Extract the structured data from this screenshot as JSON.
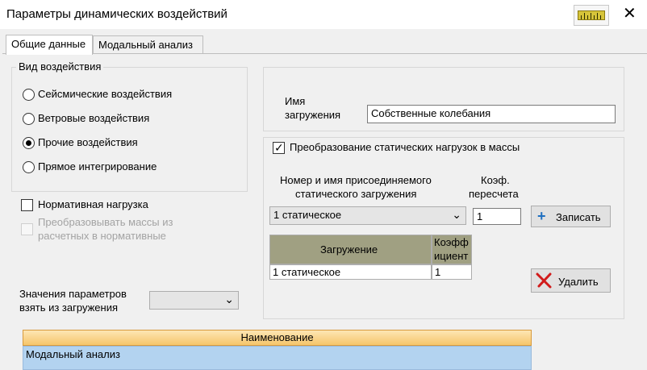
{
  "window": {
    "title": "Параметры динамических воздействий",
    "close_glyph": "✕"
  },
  "tabs": [
    {
      "label": "Общие данные"
    },
    {
      "label": "Модальный анализ"
    }
  ],
  "impact_type": {
    "title": "Вид воздействия",
    "options": [
      {
        "label": "Сейсмические воздействия",
        "selected": false
      },
      {
        "label": "Ветровые воздействия",
        "selected": false
      },
      {
        "label": "Прочие воздействия",
        "selected": true
      },
      {
        "label": "Прямое интегрирование",
        "selected": false
      }
    ]
  },
  "normative_load": {
    "label": "Нормативная нагрузка",
    "checked": false
  },
  "convert_masses": {
    "line1": "Преобразовывать массы из",
    "line2": "расчетных в нормативные",
    "checked": false,
    "disabled": true
  },
  "param_values": {
    "line1": "Значения параметров",
    "line2": "взять из загружения",
    "selected": ""
  },
  "load_name": {
    "label_line1": "Имя",
    "label_line2": "загружения",
    "value": "Собственные колебания"
  },
  "static_to_mass": {
    "checkbox_label": "Преобразование статических нагрузок в массы",
    "checked": true,
    "attach_label_line1": "Номер и имя присоединяемого",
    "attach_label_line2": "статического загружения",
    "coef_label_line1": "Коэф.",
    "coef_label_line2": "пересчета",
    "selected_load": "1 статическое",
    "coef_value": "1",
    "write_button": "Записать",
    "delete_button": "Удалить",
    "grid": {
      "headers": [
        "Загружение",
        "Коэфф",
        "ициент"
      ],
      "rows": [
        {
          "load": "1 статическое",
          "coef": "1"
        }
      ]
    }
  },
  "bottom_table": {
    "header": "Наименование",
    "rows": [
      "Модальный анализ"
    ]
  },
  "icons": {
    "ruler": "ruler-icon",
    "plus": "+",
    "delete": "delete-x-icon"
  },
  "colors": {
    "accent_plus": "#1f6fc0",
    "delete_red": "#d11b1b",
    "table_header": "#f6c56b",
    "table_row": "#b3d3f0"
  }
}
